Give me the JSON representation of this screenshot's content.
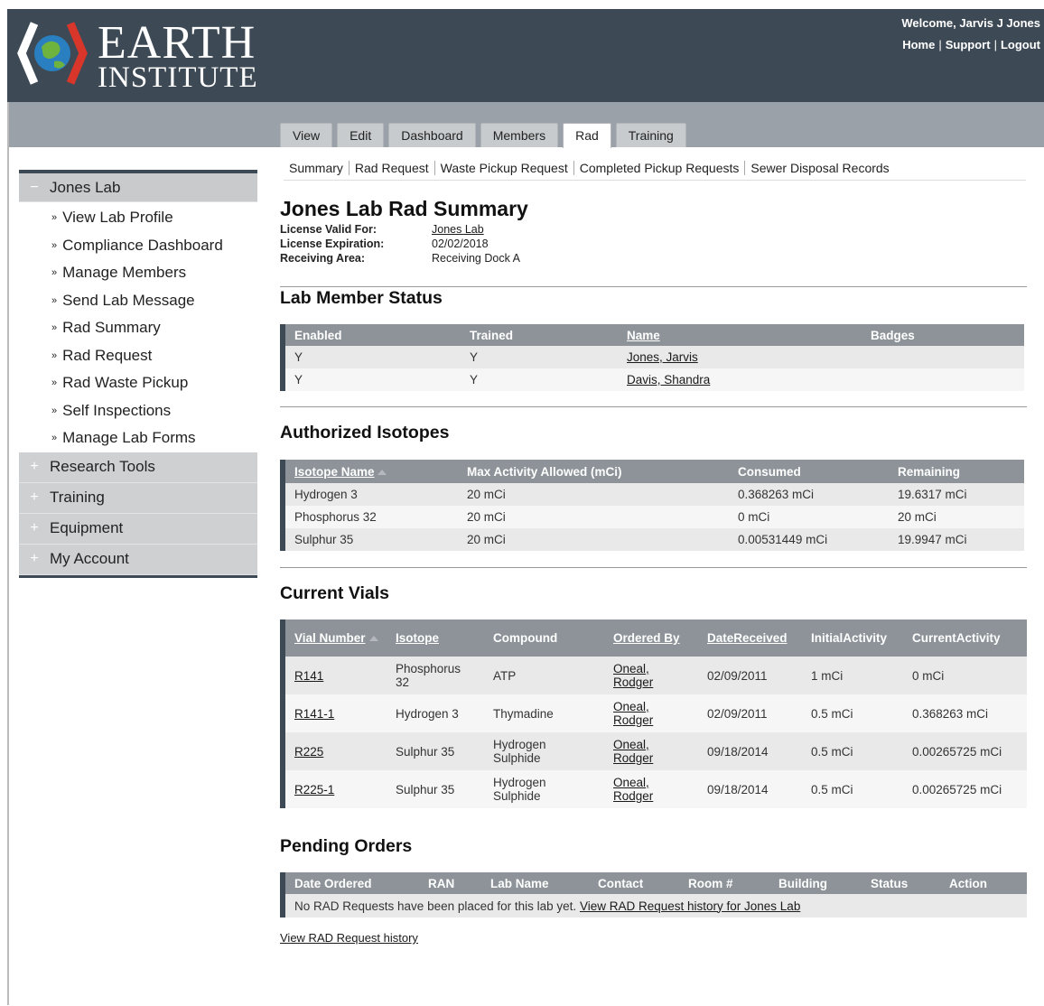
{
  "header": {
    "logo_line1": "EARTH",
    "logo_line2": "INSTITUTE",
    "welcome": "Welcome, Jarvis J Jones",
    "links": [
      "Home",
      "Support",
      "Logout"
    ]
  },
  "tabs": [
    "View",
    "Edit",
    "Dashboard",
    "Members",
    "Rad",
    "Training"
  ],
  "active_tab": "Rad",
  "subnav": [
    "Summary",
    "Rad Request",
    "Waste Pickup Request",
    "Completed Pickup Requests",
    "Sewer Disposal Records"
  ],
  "sidebar": {
    "open_section": {
      "sign": "−",
      "label": "Jones Lab"
    },
    "items": [
      {
        "label": "View Lab Profile"
      },
      {
        "label": "Compliance Dashboard"
      },
      {
        "label": "Manage Members"
      },
      {
        "label": "Send Lab Message"
      },
      {
        "label": "Rad Summary"
      },
      {
        "label": "Rad Request"
      },
      {
        "label": "Rad Waste Pickup"
      },
      {
        "label": "Self Inspections"
      },
      {
        "label": "Manage Lab Forms"
      }
    ],
    "bullet": "»",
    "sections": [
      {
        "sign": "+",
        "label": "Research Tools"
      },
      {
        "sign": "+",
        "label": "Training"
      },
      {
        "sign": "+",
        "label": "Equipment"
      },
      {
        "sign": "+",
        "label": "My Account"
      }
    ]
  },
  "page": {
    "title": "Jones Lab Rad Summary",
    "license_valid_for_label": "License Valid For:",
    "license_valid_for": "Jones Lab",
    "license_expiration_label": "License Expiration:",
    "license_expiration": "02/02/2018",
    "receiving_area_label": "Receiving Area:",
    "receiving_area": "Receiving Dock A"
  },
  "members": {
    "title": "Lab Member Status",
    "headers": [
      "Enabled",
      "Trained",
      "Name",
      "Badges"
    ],
    "rows": [
      [
        "Y",
        "Y",
        "Jones, Jarvis",
        ""
      ],
      [
        "Y",
        "Y",
        "Davis, Shandra",
        ""
      ]
    ]
  },
  "isotopes": {
    "title": "Authorized Isotopes",
    "headers": [
      "Isotope Name",
      "Max Activity Allowed (mCi)",
      "Consumed",
      "Remaining"
    ],
    "rows": [
      [
        "Hydrogen 3",
        "20 mCi",
        "0.368263 mCi",
        "19.6317 mCi"
      ],
      [
        "Phosphorus 32",
        "20 mCi",
        "0 mCi",
        "20 mCi"
      ],
      [
        "Sulphur 35",
        "20 mCi",
        "0.00531449 mCi",
        "19.9947 mCi"
      ]
    ]
  },
  "vials": {
    "title": "Current Vials",
    "headers": [
      [
        "Vial Number"
      ],
      [
        "Isotope"
      ],
      [
        "Compound"
      ],
      [
        "Ordered By"
      ],
      [
        "Date",
        "Received"
      ],
      [
        "Initial",
        "Activity"
      ],
      [
        "Current",
        "Activity"
      ]
    ],
    "rows": [
      {
        "vial": "R141",
        "isotope": [
          "Phosphorus",
          "32"
        ],
        "compound": [
          "ATP"
        ],
        "ordered_by": [
          "Oneal,",
          "Rodger"
        ],
        "date": "02/09/2011",
        "initial": "1 mCi",
        "current": "0 mCi"
      },
      {
        "vial": "R141-1",
        "isotope": [
          "Hydrogen 3"
        ],
        "compound": [
          "Thymadine"
        ],
        "ordered_by": [
          "Oneal,",
          "Rodger"
        ],
        "date": "02/09/2011",
        "initial": "0.5 mCi",
        "current": "0.368263 mCi"
      },
      {
        "vial": "R225",
        "isotope": [
          "Sulphur 35"
        ],
        "compound": [
          "Hydrogen",
          "Sulphide"
        ],
        "ordered_by": [
          "Oneal,",
          "Rodger"
        ],
        "date": "09/18/2014",
        "initial": "0.5 mCi",
        "current": "0.00265725 mCi"
      },
      {
        "vial": "R225-1",
        "isotope": [
          "Sulphur 35"
        ],
        "compound": [
          "Hydrogen",
          "Sulphide"
        ],
        "ordered_by": [
          "Oneal,",
          "Rodger"
        ],
        "date": "09/18/2014",
        "initial": "0.5 mCi",
        "current": "0.00265725 mCi"
      }
    ]
  },
  "pending": {
    "title": "Pending Orders",
    "headers": [
      "Date Ordered",
      "RAN",
      "Lab Name",
      "Contact",
      "Room #",
      "Building",
      "Status",
      "Action"
    ],
    "empty_text": "No RAD Requests have been placed for this lab yet.",
    "history_link": "View RAD Request history for Jones Lab"
  },
  "bottom_link": "View RAD Request history"
}
